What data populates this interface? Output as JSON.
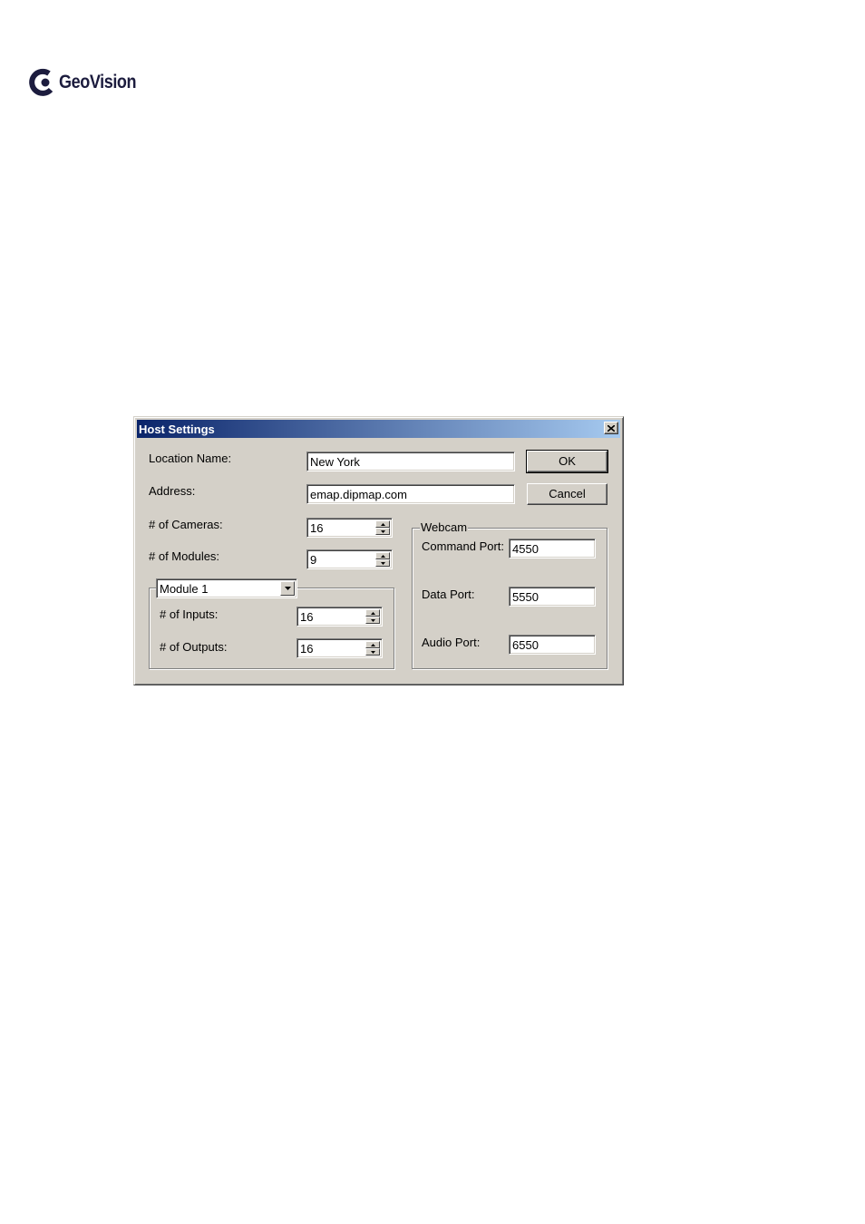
{
  "logo": {
    "text": "GeoVision"
  },
  "dialog": {
    "title": "Host Settings",
    "location_name": {
      "label": "Location Name:",
      "value": "New York"
    },
    "address": {
      "label": "Address:",
      "value": "emap.dipmap.com"
    },
    "cameras": {
      "label": "# of Cameras:",
      "value": "16"
    },
    "modules": {
      "label": "# of Modules:",
      "value": "9"
    },
    "module_select": {
      "selected": "Module 1"
    },
    "inputs": {
      "label": "# of Inputs:",
      "value": "16"
    },
    "outputs": {
      "label": "# of Outputs:",
      "value": "16"
    },
    "ok_label": "OK",
    "cancel_label": "Cancel",
    "webcam": {
      "caption": "Webcam",
      "command_port": {
        "label": "Command Port:",
        "value": "4550"
      },
      "data_port": {
        "label": "Data Port:",
        "value": "5550"
      },
      "audio_port": {
        "label": "Audio Port:",
        "value": "6550"
      }
    }
  }
}
